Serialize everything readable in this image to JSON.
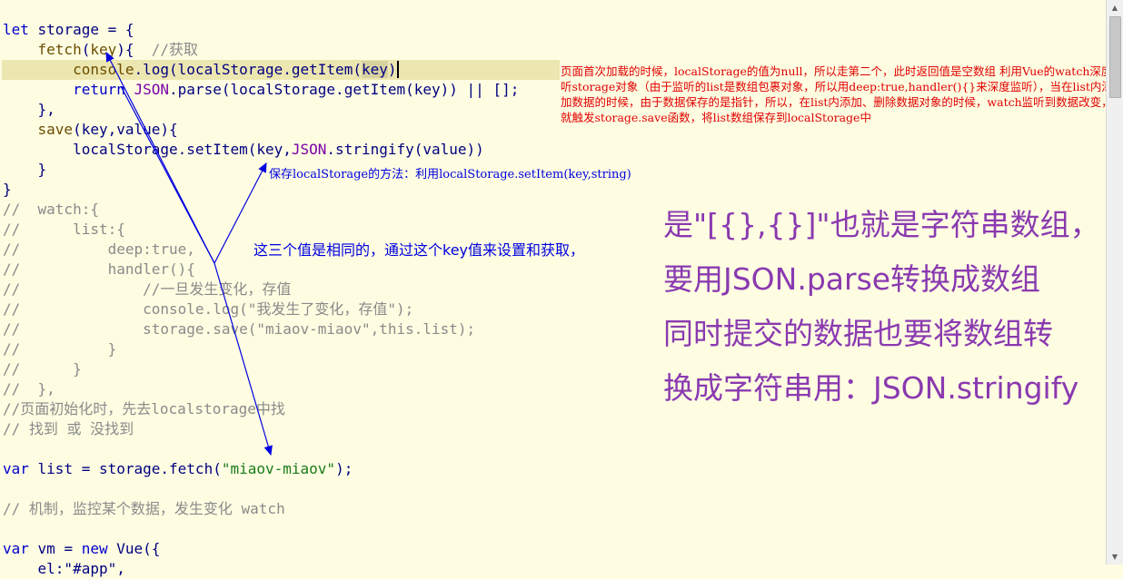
{
  "code": {
    "l1": {
      "kw": "let",
      "name": " storage = {"
    },
    "l2": {
      "fn": "fetch",
      "paren": "(",
      "arg": "key",
      "rest": "){  ",
      "cmt": "//获取"
    },
    "l3": {
      "a": "console",
      "b": ".log(localStorage.getItem(",
      "c": "key",
      "d": ")"
    },
    "l4": {
      "kw": "return ",
      "obj": "JSON",
      "rest": ".parse(localStorage.getItem(key)) || [];"
    },
    "l5": "},",
    "l6": {
      "fn": "save",
      "rest": "(key,value){"
    },
    "l7": {
      "a": "localStorage.setItem(key,",
      "obj": "JSON",
      "rest": ".stringify(value))"
    },
    "l8": "}",
    "l9": "}",
    "l10": "//  watch:{",
    "l11": "//      list:{",
    "l12": "//          deep:true,",
    "l13": "//          handler(){",
    "l14": "//              //一旦发生变化，存值",
    "l15": "//              console.log(\"我发生了变化，存值\");",
    "l16": "//              storage.save(\"miaov-miaov\",this.list);",
    "l17": "//          }",
    "l18": "//      }",
    "l19": "//  },",
    "l20": "//页面初始化时，先去localstorage中找",
    "l21": "// 找到 或 没找到",
    "l22": {
      "kw": "var",
      "a": " list = storage.fetch(",
      "str": "\"miaov-miaov\"",
      "b": ");"
    },
    "l23": "// 机制，监控某个数据，发生变化 watch",
    "l24": {
      "kw": "var",
      "a": " vm = ",
      "kw2": "new",
      "b": " Vue({"
    },
    "l25": "    el:\"#app\","
  },
  "notes": {
    "red": "页面首次加载的时候，localStorage的值为null，所以走第二个，此时返回值是空数组 利用Vue的watch深度监听storage对象（由于监听的list是数组包裹对象，所以用deep:true,handler(){}来深度监听），当在list内添加数据的时候，由于数据保存的是指针，所以，在list内添加、删除数据对象的时候，watch监听到数据改变，就触发storage.save函数，将list数组保存到localStorage中",
    "blue_save": "保存localStorage的方法：利用localStorage.setItem(key,string)",
    "blue_key": "这三个值是相同的，通过这个key值来设置和获取，",
    "purple": [
      "是\"[{},{}]\"也就是字符串数组，",
      "要用JSON.parse转换成数组",
      "同时提交的数据也要将数组转",
      "换成字符串用：JSON.stringify"
    ]
  },
  "icons": {
    "scroll_up": "scroll-up-arrow-icon",
    "scroll_down": "scroll-down-arrow-icon"
  }
}
